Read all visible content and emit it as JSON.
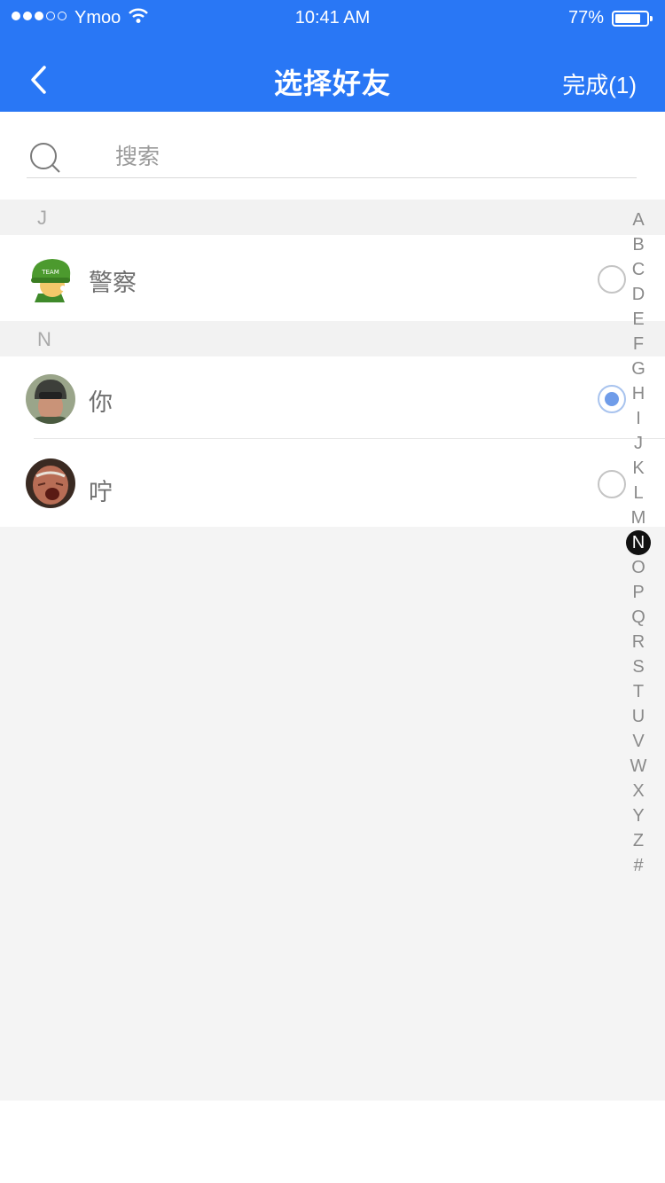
{
  "status_bar": {
    "carrier": "Ymoo",
    "time": "10:41 AM",
    "battery": "77%"
  },
  "header": {
    "title": "选择好友",
    "done_label": "完成(1)"
  },
  "search": {
    "placeholder": "搜索"
  },
  "groups": [
    {
      "letter": "J",
      "contacts": [
        {
          "name": "警察",
          "selected": false
        }
      ]
    },
    {
      "letter": "N",
      "contacts": [
        {
          "name": "你",
          "selected": true
        },
        {
          "name": "咛",
          "selected": false
        }
      ]
    }
  ],
  "index_letters": [
    "A",
    "B",
    "C",
    "D",
    "E",
    "F",
    "G",
    "H",
    "I",
    "J",
    "K",
    "L",
    "M",
    "N",
    "O",
    "P",
    "Q",
    "R",
    "S",
    "T",
    "U",
    "V",
    "W",
    "X",
    "Y",
    "Z",
    "#"
  ],
  "active_index": "N",
  "colors": {
    "accent": "#2977f5",
    "radio_selected": "#6f9ce9"
  }
}
